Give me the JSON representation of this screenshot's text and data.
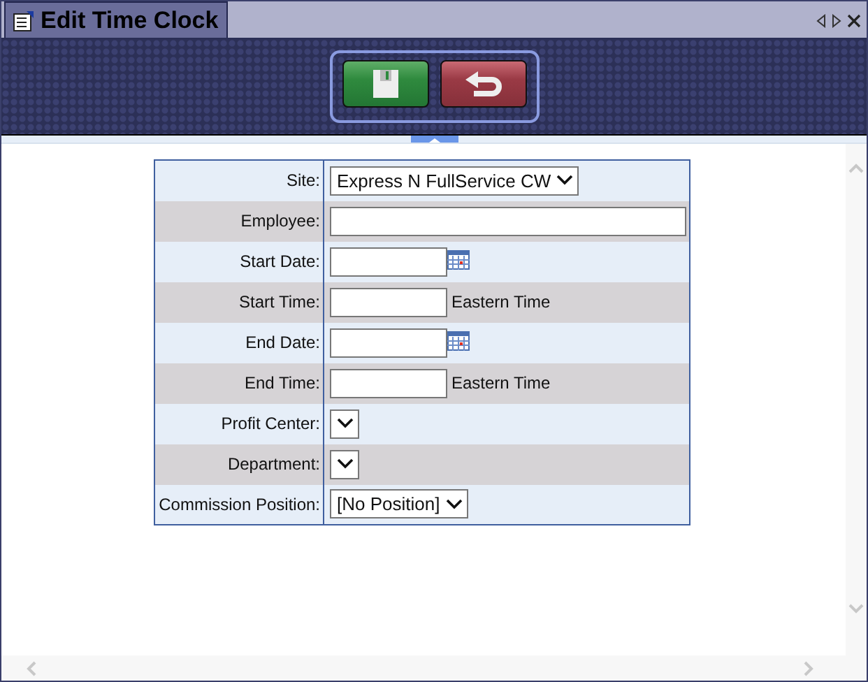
{
  "window": {
    "title": "Edit Time Clock"
  },
  "toolbar": {
    "buttons": [
      {
        "kind": "save"
      },
      {
        "kind": "undo"
      }
    ]
  },
  "form": {
    "fields": [
      {
        "kind": "select",
        "label": "Site:",
        "value": "Express N FullService CW"
      },
      {
        "kind": "text",
        "label": "Employee:"
      },
      {
        "kind": "date",
        "label": "Start Date:"
      },
      {
        "kind": "time",
        "label": "Start Time:",
        "suffix": "Eastern Time"
      },
      {
        "kind": "date",
        "label": "End Date:"
      },
      {
        "kind": "time",
        "label": "End Time:",
        "suffix": "Eastern Time"
      },
      {
        "kind": "select",
        "label": "Profit Center:"
      },
      {
        "kind": "select",
        "label": "Department:"
      },
      {
        "kind": "select",
        "label": "Commission Position:",
        "value": "[No Position]"
      }
    ]
  }
}
